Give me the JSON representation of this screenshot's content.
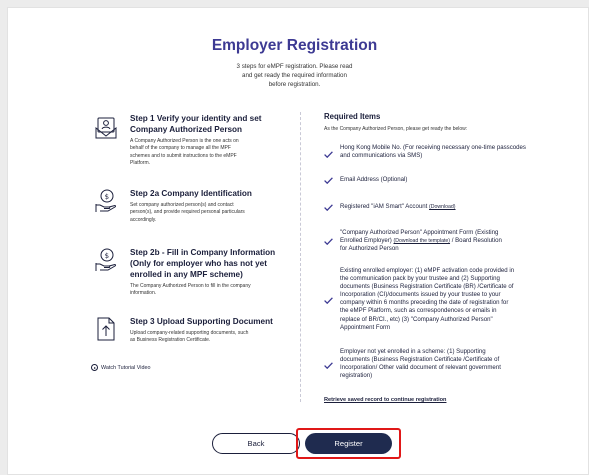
{
  "header": {
    "title": "Employer Registration",
    "subtitle_lines": [
      "3 steps for eMPF registration. Please read",
      "and get ready the required information",
      "before registration."
    ]
  },
  "steps": [
    {
      "icon": "verify-identity-icon",
      "title_lines": [
        "Step 1 Verify your identity and set",
        "Company Authorized Person"
      ],
      "desc_lines": [
        "A Company Authorized Person is the one acts on",
        "behalf of the company to manage all the MPF",
        "schemes and to submit instructions to the eMPF",
        "Platform."
      ]
    },
    {
      "icon": "company-identification-icon",
      "title_lines": [
        "Step 2a Company Identification"
      ],
      "desc_lines": [
        "Set company authorized person(s) and contact",
        "person(s), and provide required personal particulars",
        "accordingly."
      ]
    },
    {
      "icon": "company-information-icon",
      "title_lines": [
        "Step 2b - Fill in Company Information",
        "(Only for employer who has not yet",
        "enrolled in any MPF scheme)"
      ],
      "desc_lines": [
        "The Company Authorized Person to fill in the company",
        "information."
      ]
    },
    {
      "icon": "upload-document-icon",
      "title_lines": [
        "Step 3 Upload Supporting Document"
      ],
      "desc_lines": [
        "Upload company-related supporting documents, such",
        "as Business Registration Certificate."
      ]
    }
  ],
  "tutorial": {
    "label": "Watch Tutorial Video",
    "icon": "play-circle-icon"
  },
  "requirements": {
    "title": "Required Items",
    "subtitle": "As the Company Authorized Person, please get ready the below:",
    "items": [
      {
        "lines": [
          "Hong Kong Mobile No. (For receiving necessary one-time passcodes",
          "and communications via SMS)"
        ]
      },
      {
        "lines": [
          "Email Address (Optional)"
        ]
      },
      {
        "text": "Registered \"iAM Smart\" Account ",
        "link": "(Download)"
      },
      {
        "line1": "\"Company Authorized Person\" Appointment Form (Existing",
        "line2_pre": "Enrolled Employer) ",
        "line2_link": "(Download the template)",
        "line2_post": " / Board Resolution",
        "line3": "for Authorized Person"
      },
      {
        "lines": [
          "Existing enrolled employer: (1) eMPF activation code provided in",
          "the communication pack by your trustee and (2) Supporting",
          "documents (Business Registration Certificate (BR) /Certificate of",
          "Incorporation (CI)/documents issued by your trustee to your",
          "company within 6 months preceding the date of registration for",
          "the eMPF Platform, such as correspondences or emails in",
          "replace of BR/CI., etc) (3) \"Company Authorized Person\"",
          "Appointment Form"
        ]
      },
      {
        "lines": [
          "Employer not yet enrolled in a scheme: (1) Supporting",
          "documents (Business Registration Certificate /Certificate of",
          "Incorporation/ Other valid document of relevant government",
          "registration)"
        ]
      }
    ],
    "retrieve_link": "Retrieve saved record to continue registration"
  },
  "actions": {
    "back_label": "Back",
    "register_label": "Register"
  },
  "colors": {
    "title": "#3d3a93",
    "check": "#3d3a93",
    "primary_button": "#1f2b4f",
    "highlight_box": "#e01818"
  }
}
